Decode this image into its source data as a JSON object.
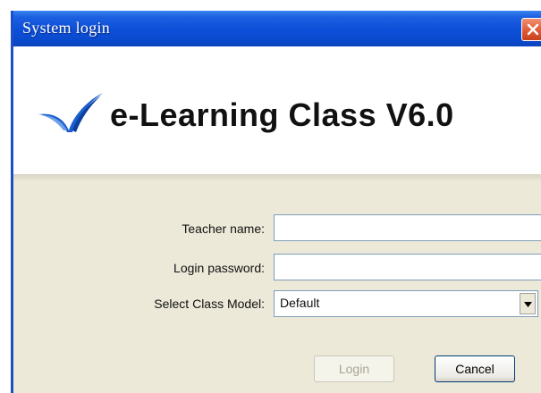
{
  "window": {
    "title": "System login"
  },
  "banner": {
    "product_name": "e-Learning Class V6.0"
  },
  "form": {
    "teacher_name_label": "Teacher name:",
    "teacher_name_value": "",
    "login_password_label": "Login password:",
    "login_password_value": "",
    "class_model_label": "Select Class Model:",
    "class_model_selected": "Default"
  },
  "buttons": {
    "login_label": "Login",
    "cancel_label": "Cancel"
  },
  "icons": {
    "close": "close-icon",
    "logo": "swoosh-logo-icon",
    "dropdown": "chevron-down-icon"
  },
  "colors": {
    "titlebar": "#0c4fd8",
    "close_button": "#e05a36",
    "dialog_background": "#ece9d8",
    "logo_blue": "#1a5fd0"
  }
}
